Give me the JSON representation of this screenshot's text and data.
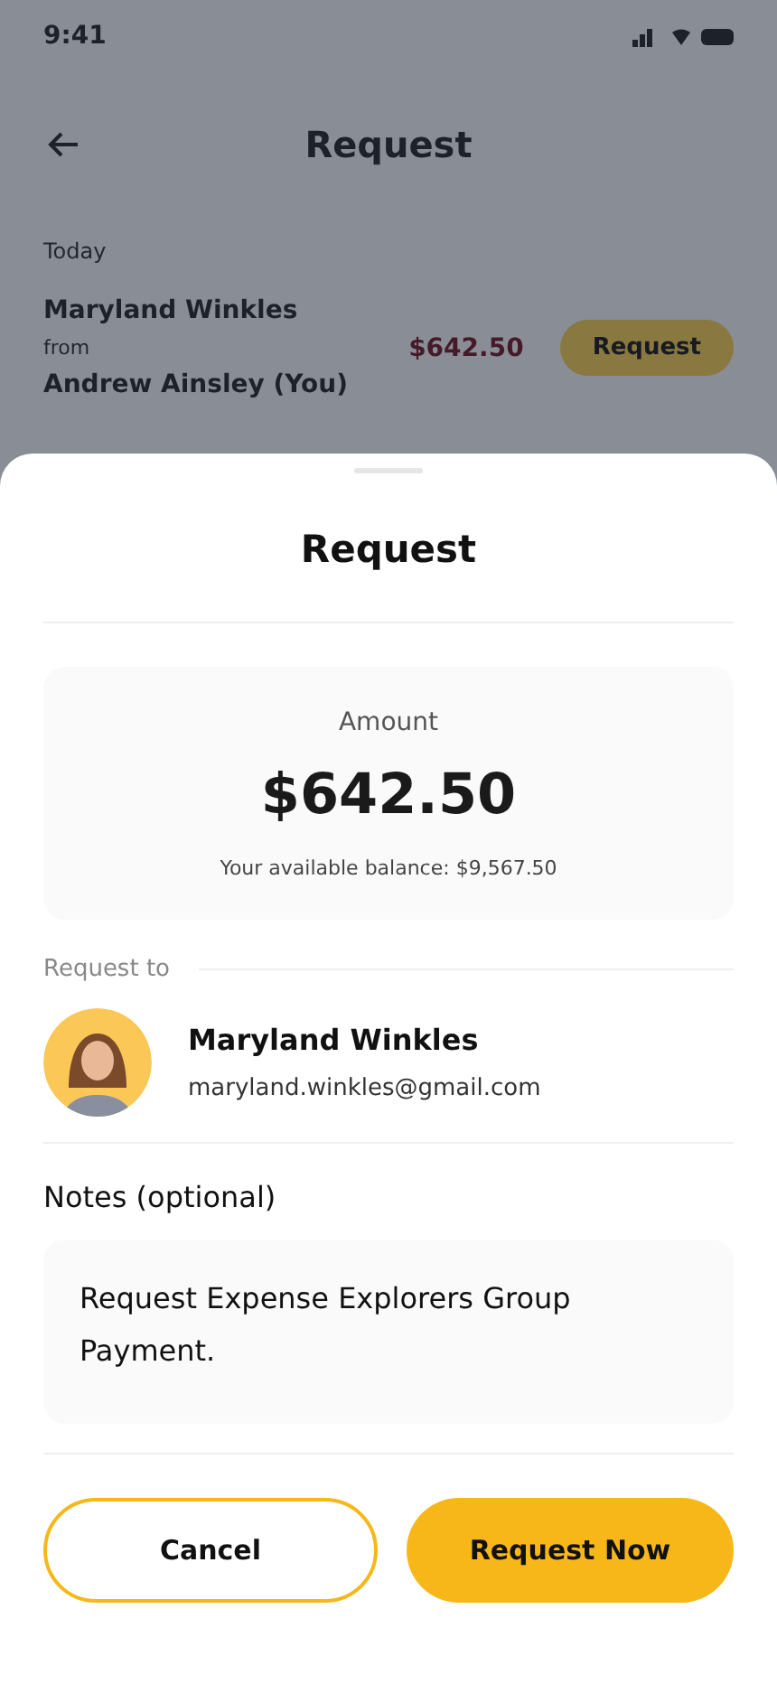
{
  "background": {
    "status_time": "9:41",
    "title": "Request",
    "section": "Today",
    "item": {
      "name": "Maryland Winkles",
      "direction": "from",
      "counterpart": "Andrew Ainsley (You)",
      "amount": "$642.50",
      "action": "Request"
    }
  },
  "sheet": {
    "title": "Request",
    "amount_label": "Amount",
    "amount": "$642.50",
    "balance": "Your available balance: $9,567.50",
    "recipient_label": "Request to",
    "recipient": {
      "name": "Maryland Winkles",
      "email": "maryland.winkles@gmail.com"
    },
    "notes_label": "Notes (optional)",
    "notes": "Request Expense Explorers Group Payment.",
    "buttons": [
      {
        "label": "Cancel",
        "kind": "outline"
      },
      {
        "label": "Request Now",
        "kind": "filled"
      }
    ]
  }
}
